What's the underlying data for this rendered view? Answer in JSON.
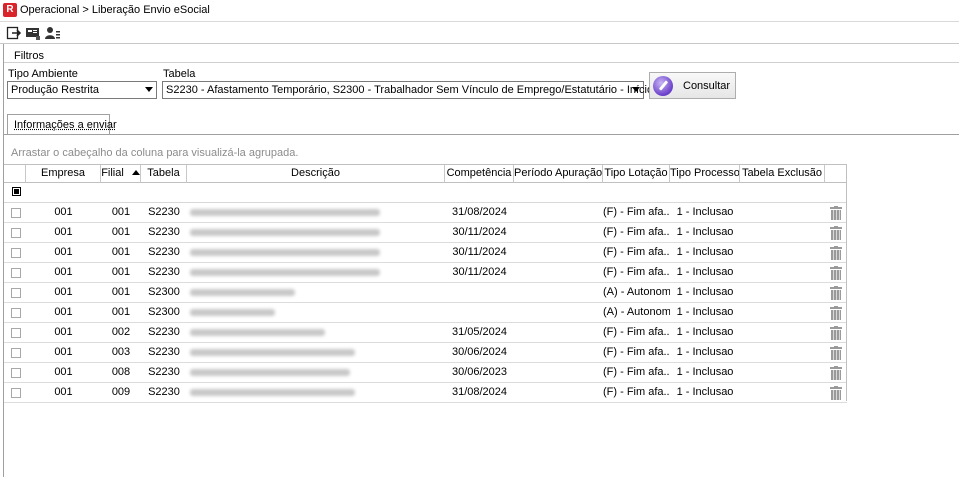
{
  "window": {
    "title": "Operacional > Liberação Envio eSocial",
    "logo_icon": "app-logo-icon"
  },
  "toolbar": {
    "icons": [
      "export-icon",
      "id-card-icon",
      "user-list-icon"
    ]
  },
  "filtros": {
    "title": "Filtros",
    "tipo_ambiente": {
      "label": "Tipo Ambiente",
      "value": "Produção Restrita"
    },
    "tabela": {
      "label": "Tabela",
      "value": "S2230 - Afastamento Temporário, S2300 - Trabalhador Sem Vínculo de Emprego/Estatutário - Início"
    },
    "consultar_label": "Consultar"
  },
  "tab": {
    "label": "Informações a enviar"
  },
  "grid": {
    "group_hint": "Arrastar o cabeçalho da coluna para visualizá-la agrupada.",
    "columns": [
      "Empresa",
      "Filial",
      "Tabela",
      "Descrição",
      "Competência",
      "Período Apuração",
      "Tipo Lotação",
      "Tipo Processo",
      "Tabela Exclusão"
    ],
    "sort_column": "Filial",
    "rows": [
      {
        "empresa": "001",
        "filial": "001",
        "tabela": "S2230",
        "competencia": "31/08/2024",
        "periodo": "",
        "tipo_lotacao": "(F) - Fim afa...",
        "tipo_processo": "1 - Inclusao",
        "tabela_exclusao": ""
      },
      {
        "empresa": "001",
        "filial": "001",
        "tabela": "S2230",
        "competencia": "30/11/2024",
        "periodo": "",
        "tipo_lotacao": "(F) - Fim afa...",
        "tipo_processo": "1 - Inclusao",
        "tabela_exclusao": ""
      },
      {
        "empresa": "001",
        "filial": "001",
        "tabela": "S2230",
        "competencia": "30/11/2024",
        "periodo": "",
        "tipo_lotacao": "(F) - Fim afa...",
        "tipo_processo": "1 - Inclusao",
        "tabela_exclusao": ""
      },
      {
        "empresa": "001",
        "filial": "001",
        "tabela": "S2230",
        "competencia": "30/11/2024",
        "periodo": "",
        "tipo_lotacao": "(F) - Fim afa...",
        "tipo_processo": "1 - Inclusao",
        "tabela_exclusao": ""
      },
      {
        "empresa": "001",
        "filial": "001",
        "tabela": "S2300",
        "competencia": "",
        "periodo": "",
        "tipo_lotacao": "(A) - Autonomo",
        "tipo_processo": "1 - Inclusao",
        "tabela_exclusao": ""
      },
      {
        "empresa": "001",
        "filial": "001",
        "tabela": "S2300",
        "competencia": "",
        "periodo": "",
        "tipo_lotacao": "(A) - Autonomo",
        "tipo_processo": "1 - Inclusao",
        "tabela_exclusao": ""
      },
      {
        "empresa": "001",
        "filial": "002",
        "tabela": "S2230",
        "competencia": "31/05/2024",
        "periodo": "",
        "tipo_lotacao": "(F) - Fim afa...",
        "tipo_processo": "1 - Inclusao",
        "tabela_exclusao": ""
      },
      {
        "empresa": "001",
        "filial": "003",
        "tabela": "S2230",
        "competencia": "30/06/2024",
        "periodo": "",
        "tipo_lotacao": "(F) - Fim afa...",
        "tipo_processo": "1 - Inclusao",
        "tabela_exclusao": ""
      },
      {
        "empresa": "001",
        "filial": "008",
        "tabela": "S2230",
        "competencia": "30/06/2023",
        "periodo": "",
        "tipo_lotacao": "(F) - Fim afa...",
        "tipo_processo": "1 - Inclusao",
        "tabela_exclusao": ""
      },
      {
        "empresa": "001",
        "filial": "009",
        "tabela": "S2230",
        "competencia": "31/08/2024",
        "periodo": "",
        "tipo_lotacao": "(F) - Fim afa...",
        "tipo_processo": "1 - Inclusao",
        "tabela_exclusao": ""
      }
    ]
  }
}
